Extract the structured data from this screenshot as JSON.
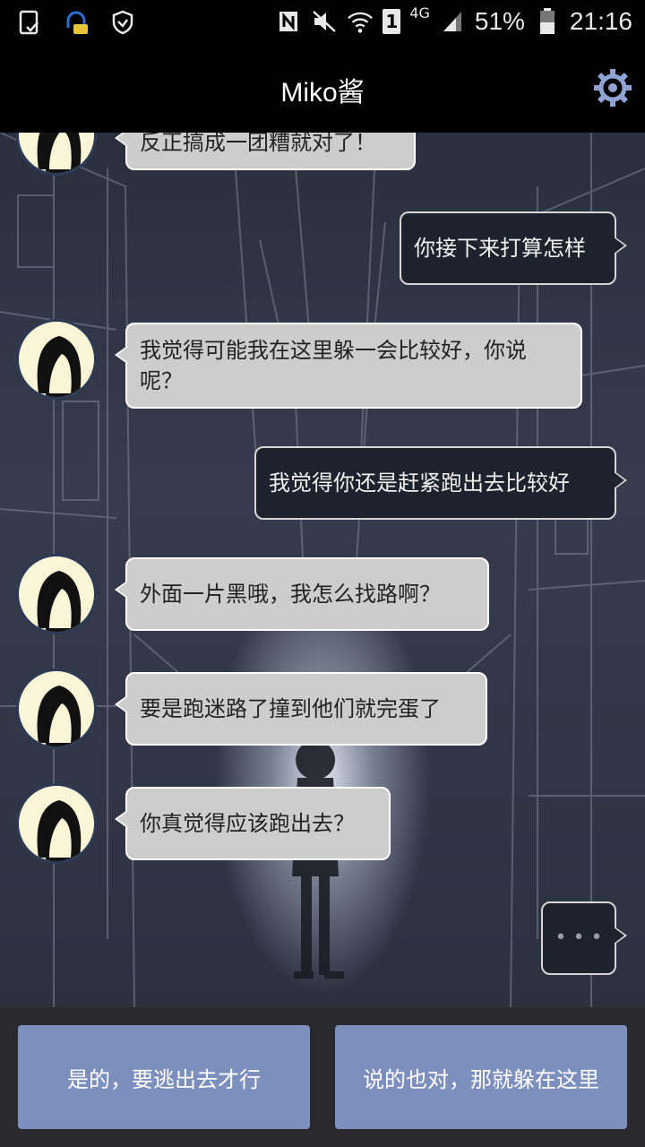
{
  "status_bar": {
    "battery_percent": "51%",
    "time": "21:16",
    "network": "4G",
    "sim": "1",
    "icons": [
      "screenshot-icon",
      "chat-notification-icon",
      "shield-icon",
      "nfc-icon",
      "mute-icon",
      "wifi-icon",
      "signal-icon",
      "battery-icon"
    ]
  },
  "header": {
    "title": "Miko酱",
    "settings_icon": "gear-icon"
  },
  "messages": [
    {
      "side": "left",
      "text": "反正搞成一团糟就对了！"
    },
    {
      "side": "right",
      "text": "你接下来打算怎样"
    },
    {
      "side": "left",
      "text": "我觉得可能我在这里躲一会比较好，你说呢？"
    },
    {
      "side": "right",
      "text": "我觉得你还是赶紧跑出去比较好"
    },
    {
      "side": "left",
      "text": "外面一片黑哦，我怎么找路啊？"
    },
    {
      "side": "left",
      "text": "要是跑迷路了撞到他们就完蛋了"
    },
    {
      "side": "left",
      "text": "你真觉得应该跑出去？"
    }
  ],
  "typing_indicator": "• • •",
  "choices": {
    "option1": "是的，要逃出去才行",
    "option2": "说的也对，那就躲在这里"
  },
  "colors": {
    "choice_button": "#7d90bd",
    "left_bubble": "#cdcdcd",
    "right_bubble": "#1e222c",
    "gear_accent": "#8fa3d4"
  }
}
